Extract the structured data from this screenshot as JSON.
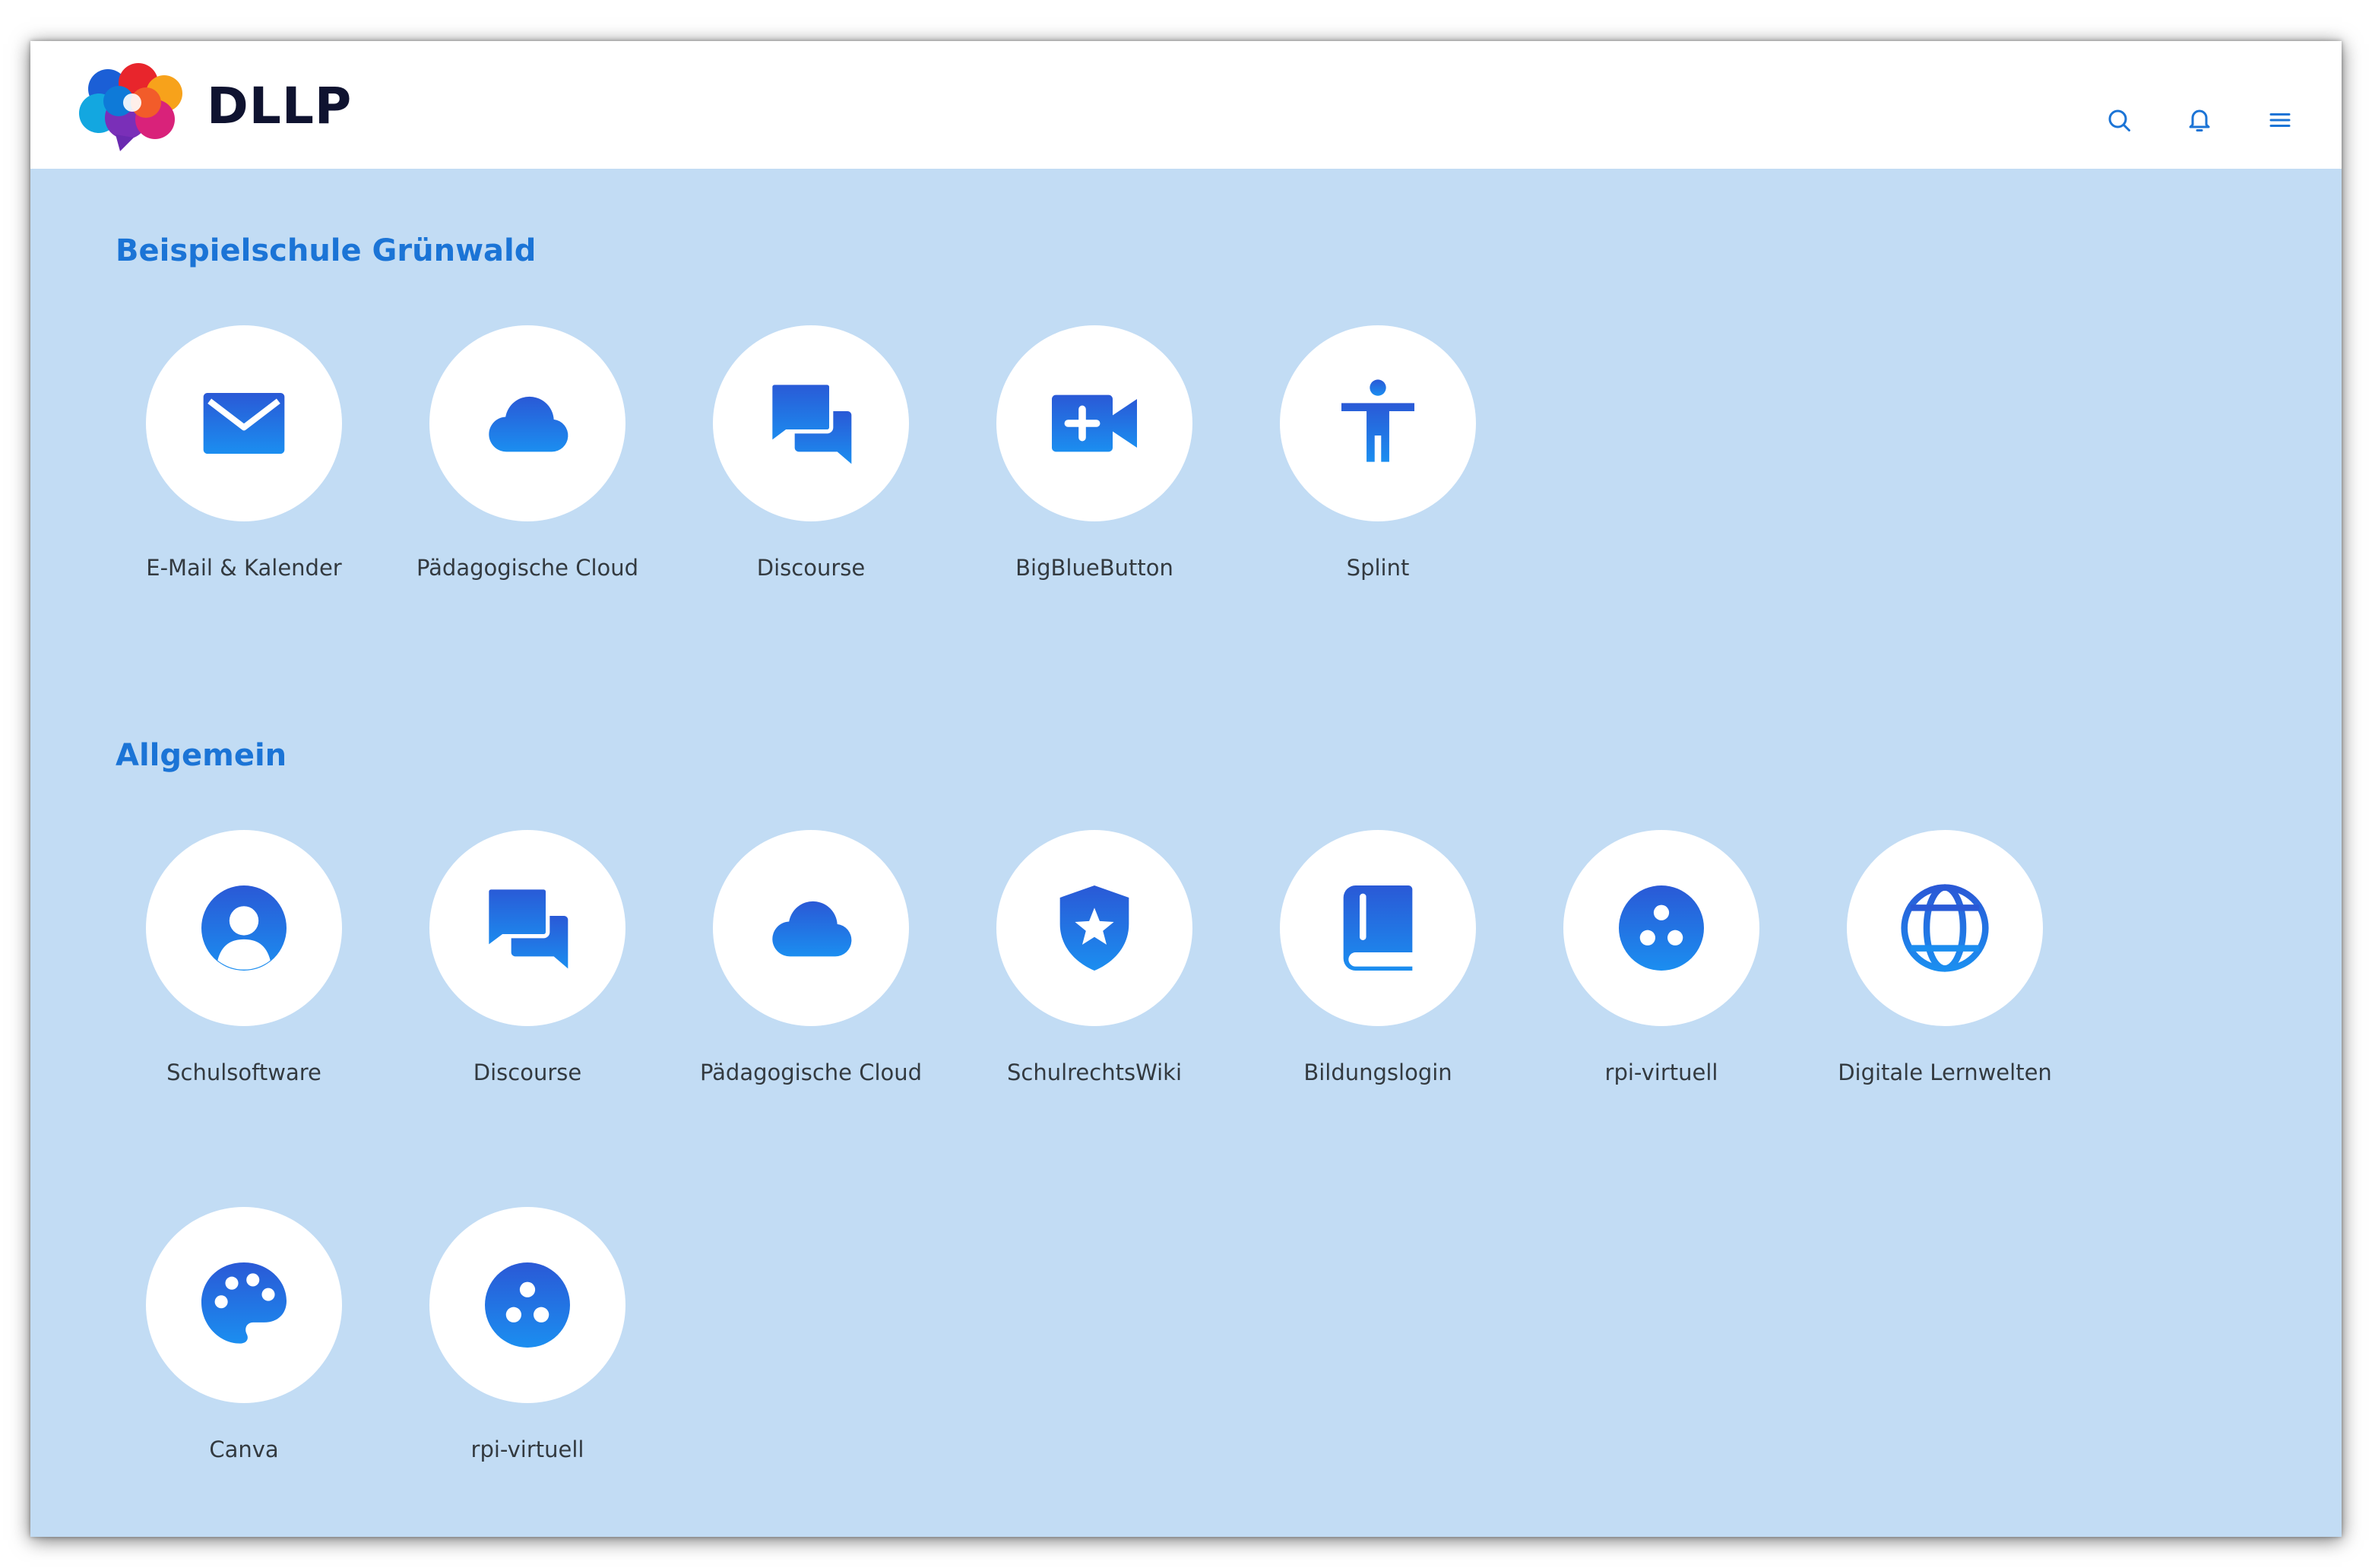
{
  "app": {
    "name": "DLLP"
  },
  "colors": {
    "background": "#c2dcf4",
    "header": "#ffffff",
    "accent": "#1b74d6",
    "icon_gradient_top": "#2a59d6",
    "icon_gradient_bottom": "#1b8ef0"
  },
  "header": {
    "icons": [
      "search-icon",
      "bell-icon",
      "menu-icon"
    ]
  },
  "sections": [
    {
      "title": "Beispielschule Grünwald",
      "tiles": [
        {
          "label": "E-Mail & Kalender",
          "icon": "envelope-icon"
        },
        {
          "label": "Pädagogische Cloud",
          "icon": "cloud-icon"
        },
        {
          "label": "Discourse",
          "icon": "chat-bubbles-icon"
        },
        {
          "label": "BigBlueButton",
          "icon": "video-plus-icon"
        },
        {
          "label": "Splint",
          "icon": "accessibility-icon"
        }
      ]
    },
    {
      "title": "Allgemein",
      "tiles": [
        {
          "label": "Schulsoftware",
          "icon": "user-circle-icon"
        },
        {
          "label": "Discourse",
          "icon": "chat-bubbles-icon"
        },
        {
          "label": "Pädagogische Cloud",
          "icon": "cloud-icon"
        },
        {
          "label": "SchulrechtsWiki",
          "icon": "shield-star-icon"
        },
        {
          "label": "Bildungslogin",
          "icon": "book-icon"
        },
        {
          "label": "rpi-virtuell",
          "icon": "dots-circle-icon"
        },
        {
          "label": "Digitale Lernwelten",
          "icon": "globe-icon"
        },
        {
          "label": "Canva",
          "icon": "palette-icon"
        },
        {
          "label": "rpi-virtuell",
          "icon": "dots-circle-icon"
        }
      ]
    }
  ]
}
